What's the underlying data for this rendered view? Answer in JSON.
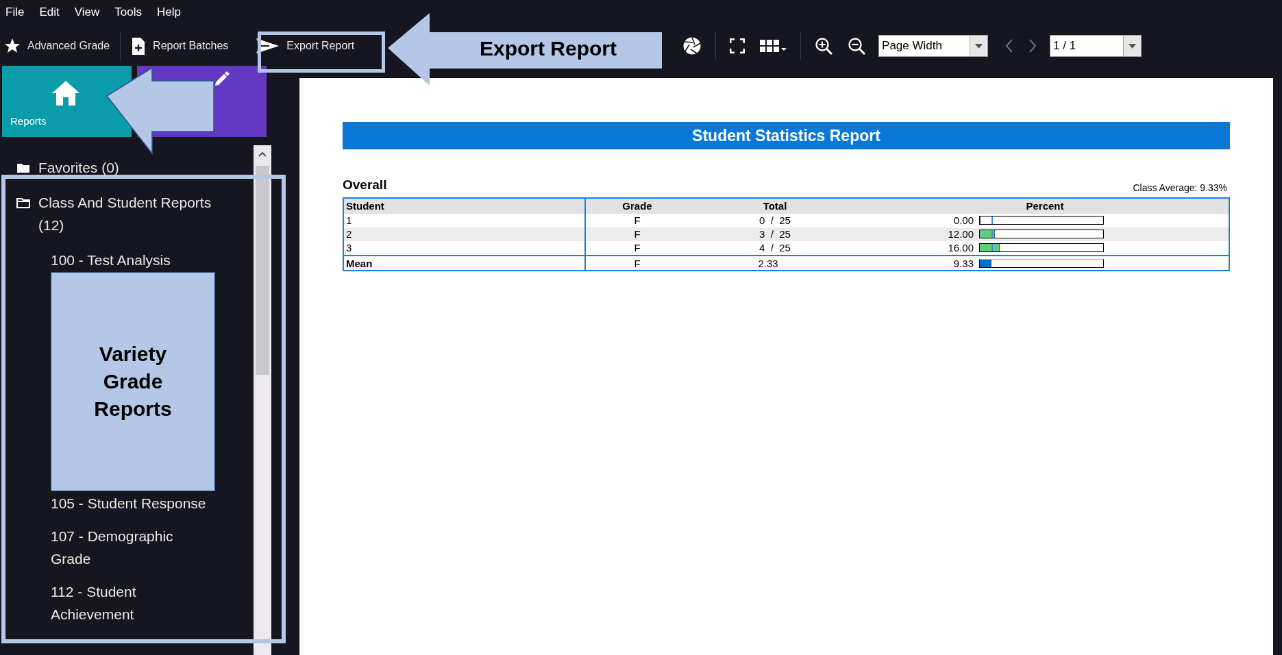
{
  "menu": [
    {
      "label": "File"
    },
    {
      "label": "Edit"
    },
    {
      "label": "View"
    },
    {
      "label": "Tools"
    },
    {
      "label": "Help"
    }
  ],
  "toolbar": {
    "left": [
      {
        "kind": "star",
        "label": "Advanced Grade"
      },
      {
        "kind": "separator"
      },
      {
        "kind": "doc-plus",
        "label": "Report Batches"
      },
      {
        "kind": "send",
        "label": "Export Report"
      }
    ],
    "right": [
      {
        "kind": "aperture"
      },
      {
        "kind": "separator"
      },
      {
        "kind": "fullscreen"
      },
      {
        "kind": "grid"
      },
      {
        "kind": "separator"
      },
      {
        "kind": "zoom-in"
      },
      {
        "kind": "zoom-out"
      },
      {
        "kind": "dropdown",
        "value": "Page Width"
      },
      {
        "kind": "prev"
      },
      {
        "kind": "next"
      },
      {
        "kind": "dropdown",
        "value": "1 / 1"
      }
    ]
  },
  "tiles": [
    {
      "kind": "home",
      "label": "Reports",
      "color": "#0a9cab"
    },
    {
      "kind": "pencil",
      "color": "#6339c4"
    }
  ],
  "tree": [
    {
      "label": "Favorites (0)",
      "expanded": false
    },
    {
      "label": "Class And Student Reports (12)",
      "expanded": true,
      "children": [
        {
          "label": "100 - Test Analysis"
        },
        {
          "label": "105 - Student Response"
        },
        {
          "label": "107 - Demographic Grade"
        },
        {
          "label": "112 - Student Achievement"
        }
      ]
    }
  ],
  "report": {
    "title": "Student Statistics Report",
    "section": "Overall",
    "class_average": "Class Average: 9.33%",
    "columns": [
      "Student",
      "Grade",
      "Total",
      "Percent"
    ],
    "rows": [
      {
        "kind": "student",
        "student": "1",
        "grade": "F",
        "total": "0  /  25",
        "percent": "0.00",
        "level": 0
      },
      {
        "kind": "student",
        "student": "2",
        "grade": "F",
        "total": "3  /  25",
        "percent": "12.00",
        "level": 0.12
      },
      {
        "kind": "student",
        "student": "3",
        "grade": "F",
        "total": "4  /  25",
        "percent": "16.00",
        "level": 0.16
      },
      {
        "kind": "mean",
        "student": "Mean",
        "grade": "F",
        "total": "2.33",
        "percent": "9.33",
        "level": 0.0933
      }
    ]
  },
  "annotations": [
    {
      "kind": "export-arrow",
      "text": "Export Report"
    },
    {
      "kind": "export-box"
    },
    {
      "kind": "reports-arrow"
    },
    {
      "kind": "tree-box"
    },
    {
      "kind": "note",
      "text": "Variety Grade Reports"
    }
  ]
}
